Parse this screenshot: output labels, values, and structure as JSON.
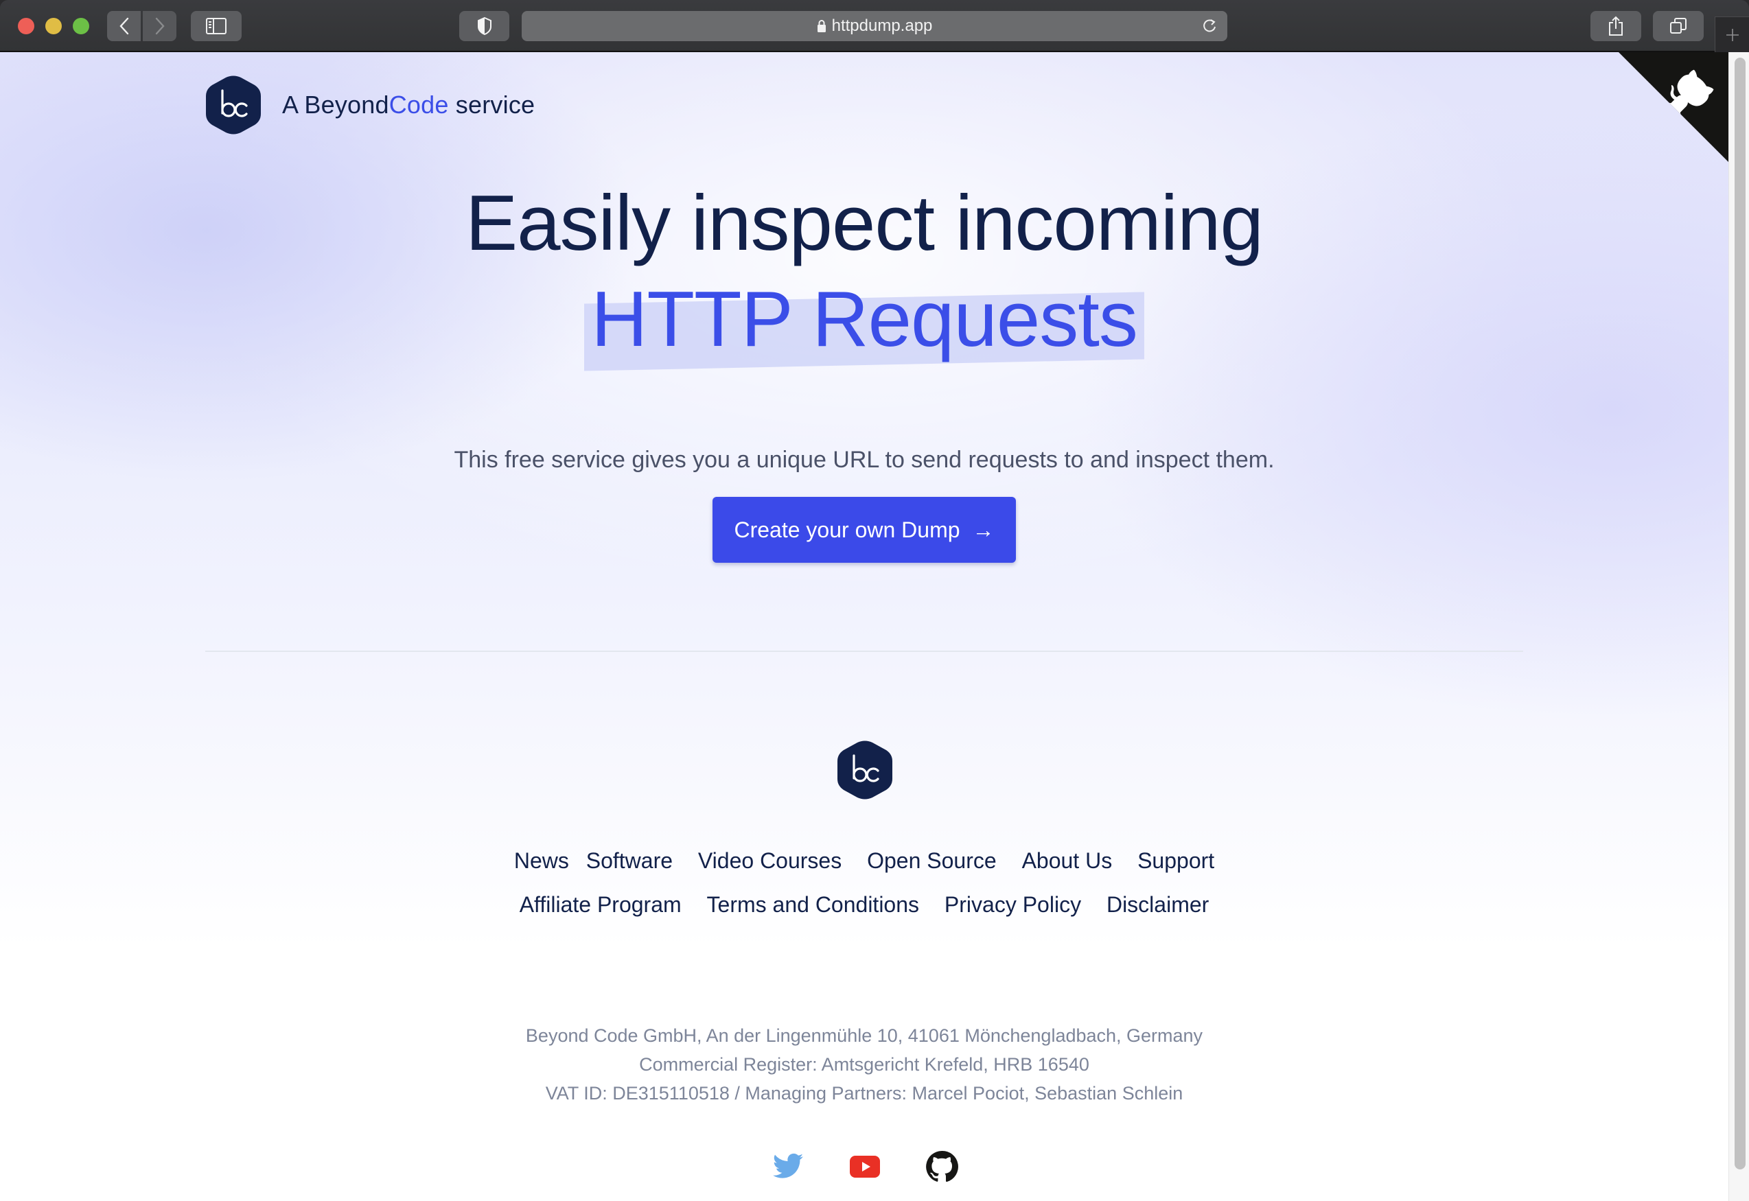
{
  "browser": {
    "url": "httpdump.app",
    "icons": {
      "back": "chevron-left-icon",
      "forward": "chevron-right-icon",
      "sidebar": "sidebar-icon",
      "privacy": "shield-icon",
      "lock": "lock-icon",
      "reload": "reload-icon",
      "share": "share-icon",
      "tabs": "tabs-overview-icon",
      "new_tab": "plus-icon"
    }
  },
  "header": {
    "brand_prefix": "A Beyond",
    "brand_accent": "Code",
    "brand_suffix": " service",
    "logo_text": "bc"
  },
  "hero": {
    "title_line1": "Easily inspect incoming",
    "title_line2": "HTTP Requests",
    "subtitle": "This free service gives you a unique URL to send requests to and inspect them.",
    "cta_label": "Create your own Dump",
    "cta_arrow": "→"
  },
  "footer": {
    "links_row1": [
      "News",
      "Software",
      "Video Courses",
      "Open Source",
      "About Us",
      "Support"
    ],
    "links_row2": [
      "Affiliate Program",
      "Terms and Conditions",
      "Privacy Policy",
      "Disclaimer"
    ],
    "legal": [
      "Beyond Code GmbH, An der Lingenmühle 10, 41061 Mönchengladbach, Germany",
      "Commercial Register: Amtsgericht Krefeld, HRB 16540",
      "VAT ID: DE315110518 / Managing Partners: Marcel Pociot, Sebastian Schlein"
    ],
    "socials": [
      "twitter",
      "youtube",
      "github"
    ]
  },
  "colors": {
    "brand_navy": "#12214a",
    "accent_blue": "#3b4ee8",
    "cta_blue": "#3b4ae9",
    "legal_gray": "#7d8599",
    "twitter": "#6aabe9",
    "youtube": "#e93025",
    "github": "#161614"
  }
}
